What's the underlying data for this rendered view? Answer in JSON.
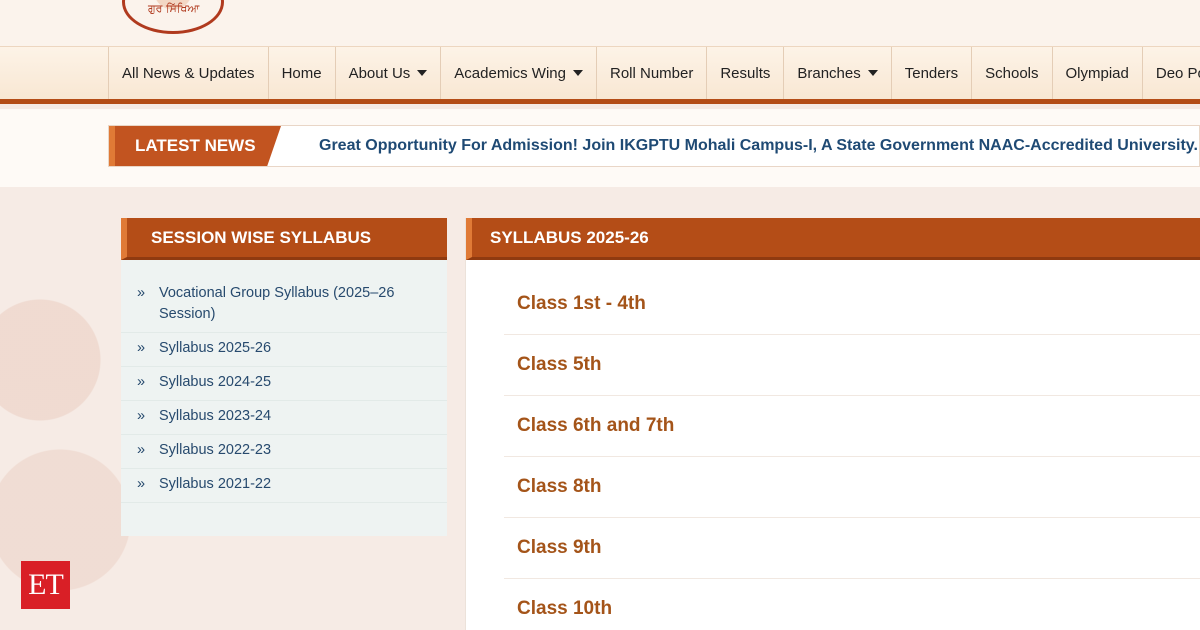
{
  "header": {
    "logo_text": "ਗੁਰ ਸਿੱਖਿਆ"
  },
  "nav": {
    "items": [
      {
        "label": "All News & Updates",
        "dropdown": false
      },
      {
        "label": "Home",
        "dropdown": false
      },
      {
        "label": "About Us",
        "dropdown": true
      },
      {
        "label": "Academics Wing",
        "dropdown": true
      },
      {
        "label": "Roll Number",
        "dropdown": false
      },
      {
        "label": "Results",
        "dropdown": false
      },
      {
        "label": "Branches",
        "dropdown": true
      },
      {
        "label": "Tenders",
        "dropdown": false
      },
      {
        "label": "Schools",
        "dropdown": false
      },
      {
        "label": "Olympiad",
        "dropdown": false
      },
      {
        "label": "Deo Por",
        "dropdown": false
      }
    ]
  },
  "news": {
    "label": "LATEST NEWS",
    "text": "Great Opportunity For Admission! Join IKGPTU Mohali Campus-I, A State Government NAAC-Accredited University. Clic"
  },
  "side_panel": {
    "title": "SESSION WISE SYLLABUS",
    "bullet": "»",
    "items": [
      "Vocational Group Syllabus (2025–26 Session)",
      "Syllabus 2025-26",
      "Syllabus 2024-25",
      "Syllabus 2023-24",
      "Syllabus 2022-23",
      "Syllabus 2021-22"
    ]
  },
  "main_panel": {
    "title": "SYLLABUS 2025-26",
    "items": [
      "Class 1st - 4th",
      "Class 5th",
      "Class 6th and 7th",
      "Class 8th",
      "Class 9th",
      "Class 10th"
    ]
  },
  "branding": {
    "et_logo": "ET"
  },
  "colors": {
    "accent": "#b44d17",
    "news_text": "#1f4a74",
    "class_text": "#a45419"
  }
}
